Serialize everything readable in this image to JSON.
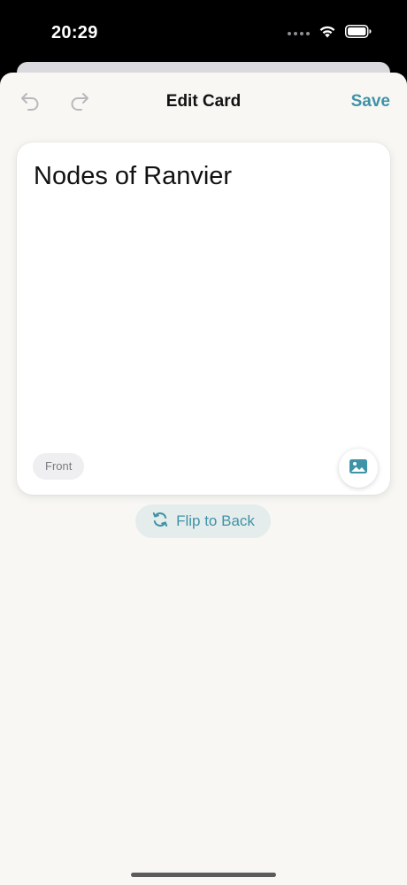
{
  "status_bar": {
    "time": "20:29"
  },
  "nav": {
    "title": "Edit Card",
    "save_label": "Save"
  },
  "card": {
    "text": "Nodes of Ranvier",
    "side_label": "Front"
  },
  "flip": {
    "label": "Flip to Back"
  },
  "colors": {
    "accent": "#3f93a7",
    "sheet_background": "#f8f7f4",
    "card_background": "#ffffff"
  },
  "icons": {
    "undo": "undo-arrow-icon",
    "redo": "redo-arrow-icon",
    "image": "photo-icon",
    "flip": "refresh-arrows-icon",
    "wifi": "wifi-icon",
    "battery": "battery-icon"
  }
}
